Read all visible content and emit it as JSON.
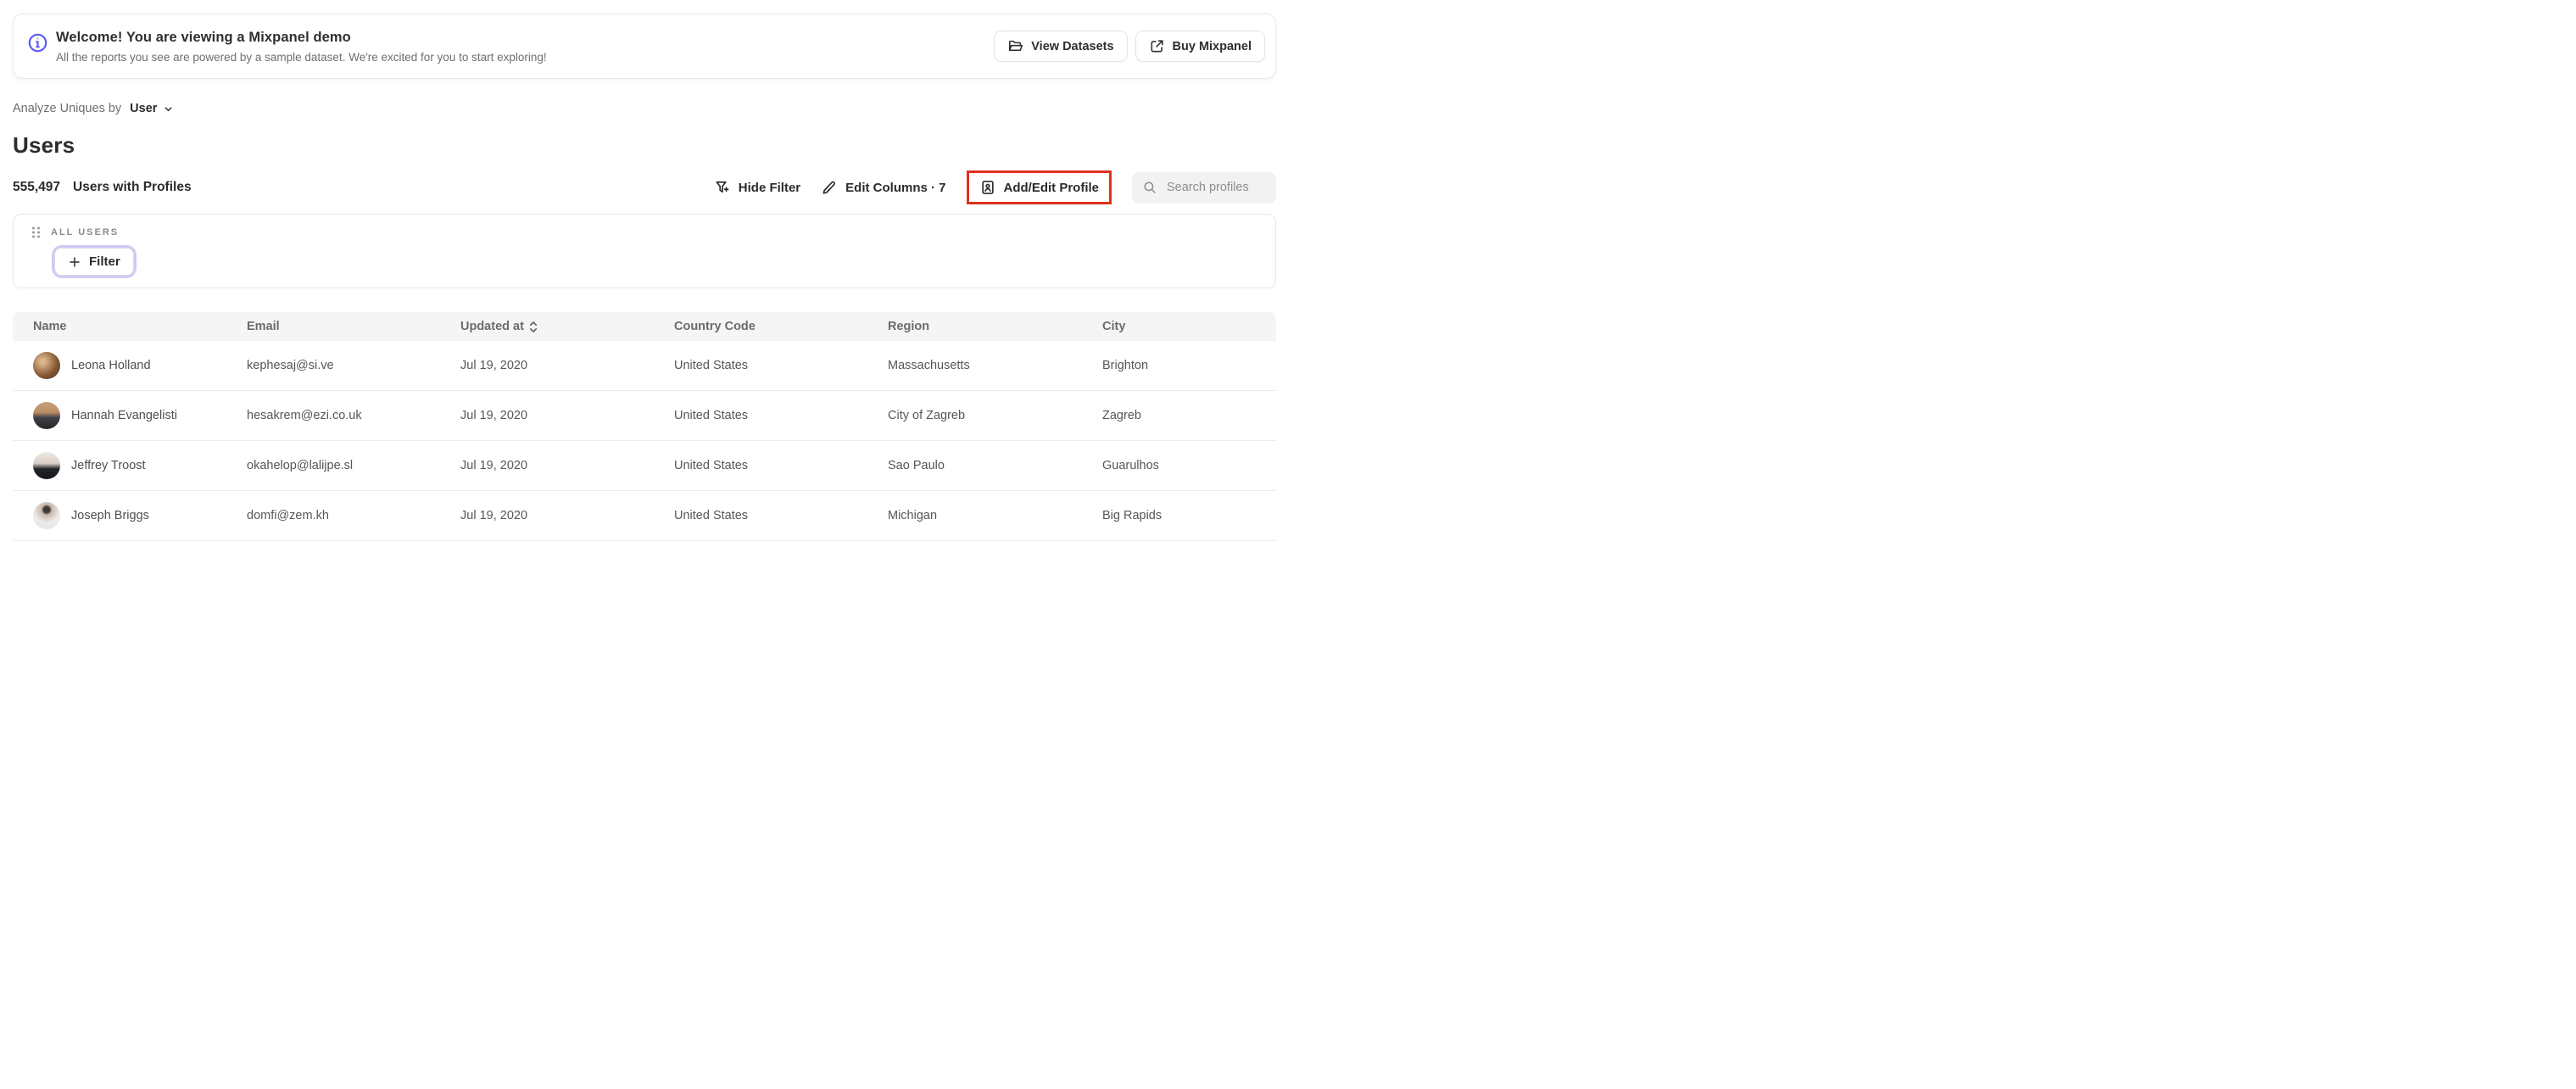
{
  "banner": {
    "title": "Welcome! You are viewing a Mixpanel demo",
    "subtitle": "All the reports you see are powered by a sample dataset. We're excited for you to start exploring!",
    "view_datasets_label": "View Datasets",
    "buy_mixpanel_label": "Buy Mixpanel",
    "info_icon": "info-circle-icon",
    "accent_color": "#5b5bf7"
  },
  "controls": {
    "label": "Analyze Uniques by",
    "value": "User"
  },
  "page": {
    "title": "Users"
  },
  "stats": {
    "count": "555,497",
    "label": "Users with Profiles"
  },
  "toolbar": {
    "hide_filter_label": "Hide Filter",
    "edit_columns_label": "Edit Columns · 7",
    "add_edit_profile_label": "Add/Edit Profile",
    "highlight_color": "#e0301e",
    "search_placeholder": "Search profiles"
  },
  "filter_panel": {
    "group_label": "ALL USERS",
    "filter_button_label": "Filter",
    "focus_ring_color": "#cfcbf7"
  },
  "table": {
    "columns": [
      "Name",
      "Email",
      "Updated at",
      "Country Code",
      "Region",
      "City"
    ],
    "sorted_column": "Updated at",
    "rows": [
      {
        "name": "Leona Holland",
        "email": "kephesaj@si.ve",
        "updated_at": "Jul 19, 2020",
        "country_code": "United States",
        "region": "Massachusetts",
        "city": "Brighton",
        "avatar": "photo-woman-warm-tones"
      },
      {
        "name": "Hannah Evangelisti",
        "email": "hesakrem@ezi.co.uk",
        "updated_at": "Jul 19, 2020",
        "country_code": "United States",
        "region": "City of Zagreb",
        "city": "Zagreb",
        "avatar": "photo-person-dark-jacket"
      },
      {
        "name": "Jeffrey Troost",
        "email": "okahelop@lalijpe.sl",
        "updated_at": "Jul 19, 2020",
        "country_code": "United States",
        "region": "Sao Paulo",
        "city": "Guarulhos",
        "avatar": "photo-man-dark-suit"
      },
      {
        "name": "Joseph Briggs",
        "email": "domfi@zem.kh",
        "updated_at": "Jul 19, 2020",
        "country_code": "United States",
        "region": "Michigan",
        "city": "Big Rapids",
        "avatar": "photo-man-light-background"
      }
    ]
  }
}
